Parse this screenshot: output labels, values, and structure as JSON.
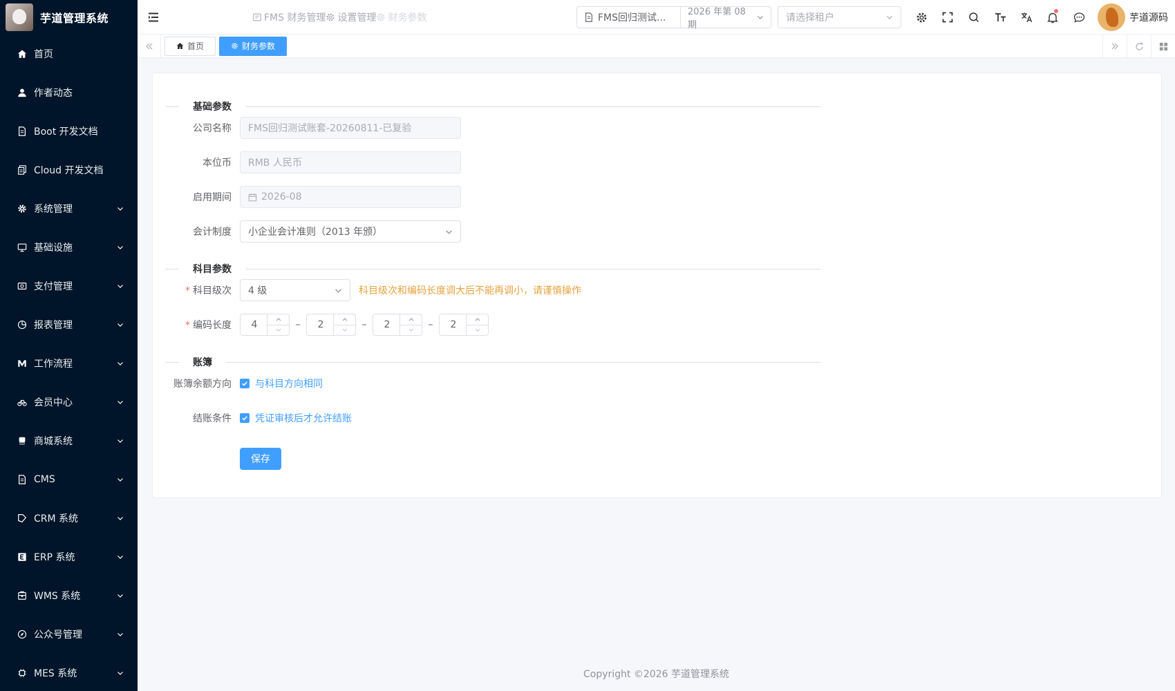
{
  "sidebar": {
    "brand_title": "芋道管理系统",
    "items": [
      {
        "label": "首页",
        "icon": "home-icon",
        "expandable": false
      },
      {
        "label": "作者动态",
        "icon": "user-icon",
        "expandable": false
      },
      {
        "label": "Boot 开发文档",
        "icon": "document-icon",
        "expandable": false
      },
      {
        "label": "Cloud 开发文档",
        "icon": "documents-icon",
        "expandable": false
      },
      {
        "label": "系统管理",
        "icon": "gear-icon",
        "expandable": true
      },
      {
        "label": "基础设施",
        "icon": "monitor-icon",
        "expandable": true
      },
      {
        "label": "支付管理",
        "icon": "payment-icon",
        "expandable": true
      },
      {
        "label": "报表管理",
        "icon": "pie-chart-icon",
        "expandable": true
      },
      {
        "label": "工作流程",
        "icon": "workflow-icon",
        "expandable": true
      },
      {
        "label": "会员中心",
        "icon": "bicycle-icon",
        "expandable": true
      },
      {
        "label": "商城系统",
        "icon": "shop-icon",
        "expandable": true
      },
      {
        "label": "CMS",
        "icon": "cms-icon",
        "expandable": true
      },
      {
        "label": "CRM 系统",
        "icon": "crm-icon",
        "expandable": true
      },
      {
        "label": "ERP 系统",
        "icon": "erp-icon",
        "expandable": true
      },
      {
        "label": "WMS 系统",
        "icon": "warehouse-icon",
        "expandable": true
      },
      {
        "label": "公众号管理",
        "icon": "compass-icon",
        "expandable": true
      },
      {
        "label": "MES 系统",
        "icon": "chip-icon",
        "expandable": true
      }
    ]
  },
  "header": {
    "breadcrumbs": [
      "FMS 财务管理",
      "设置管理",
      "财务参数"
    ],
    "account_set": "FMS回归测试...",
    "period": "2026 年第 08 期",
    "tenant_placeholder": "请选择租户",
    "username": "芋道源码"
  },
  "tabs": [
    {
      "label": "首页",
      "active": false
    },
    {
      "label": "财务参数",
      "active": true
    }
  ],
  "form": {
    "section_basic": "基础参数",
    "company_label": "公司名称",
    "company_value": "FMS回归测试账套-20260811-已复验",
    "currency_label": "本位币",
    "currency_value": "RMB 人民币",
    "period_label": "启用期间",
    "period_value": "2026-08",
    "system_label": "会计制度",
    "system_value": "小企业会计准则（2013 年颁）",
    "section_subject": "科目参数",
    "level_label": "科目级次",
    "level_value": "4 级",
    "level_hint": "科目级次和编码长度调大后不能再调小，请谨慎操作",
    "code_label": "编码长度",
    "code_values": [
      "4",
      "2",
      "2",
      "2"
    ],
    "section_ledger": "账簿",
    "balance_label": "账簿余额方向",
    "balance_option": "与科目方向相同",
    "balance_checked": true,
    "closing_label": "结账条件",
    "closing_option": "凭证审核后才允许结账",
    "closing_checked": true,
    "save_label": "保存"
  },
  "footer": {
    "copyright": "Copyright ©2026 芋道管理系统"
  },
  "colors": {
    "sidebar_bg": "#001529",
    "primary": "#409eff",
    "warning": "#e6a23c",
    "required": "#f56c6c"
  }
}
